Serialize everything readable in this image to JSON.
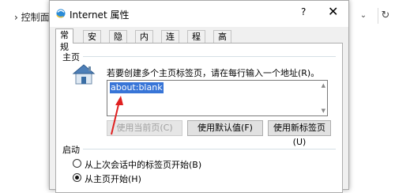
{
  "background": {
    "breadcrumb": "控制面板",
    "breadcrumb_separator": "›",
    "dropdown_icon": "chevron-down",
    "refresh_icon": "refresh"
  },
  "dialog": {
    "title": "Internet 属性",
    "help": "?",
    "close": "✕",
    "tabs": [
      "常规",
      "安全",
      "隐私",
      "内容",
      "连接",
      "程序",
      "高级"
    ],
    "active_tab": "常规"
  },
  "home_section": {
    "title": "主页",
    "instruction": "若要创建多个主页标签页，请在每行输入一个地址(R)。",
    "address_value": "about:blank",
    "buttons": {
      "use_current": "使用当前页(C)",
      "use_default": "使用默认值(F)",
      "use_new_tab": "使用新标签页(U)"
    }
  },
  "startup_section": {
    "title": "启动",
    "option_last_session": "从上次会话中的标签页开始(B)",
    "option_home": "从主页开始(H)",
    "selected": "option_home"
  },
  "colors": {
    "selection": "#3875d7",
    "annotation_arrow": "#e02020"
  }
}
